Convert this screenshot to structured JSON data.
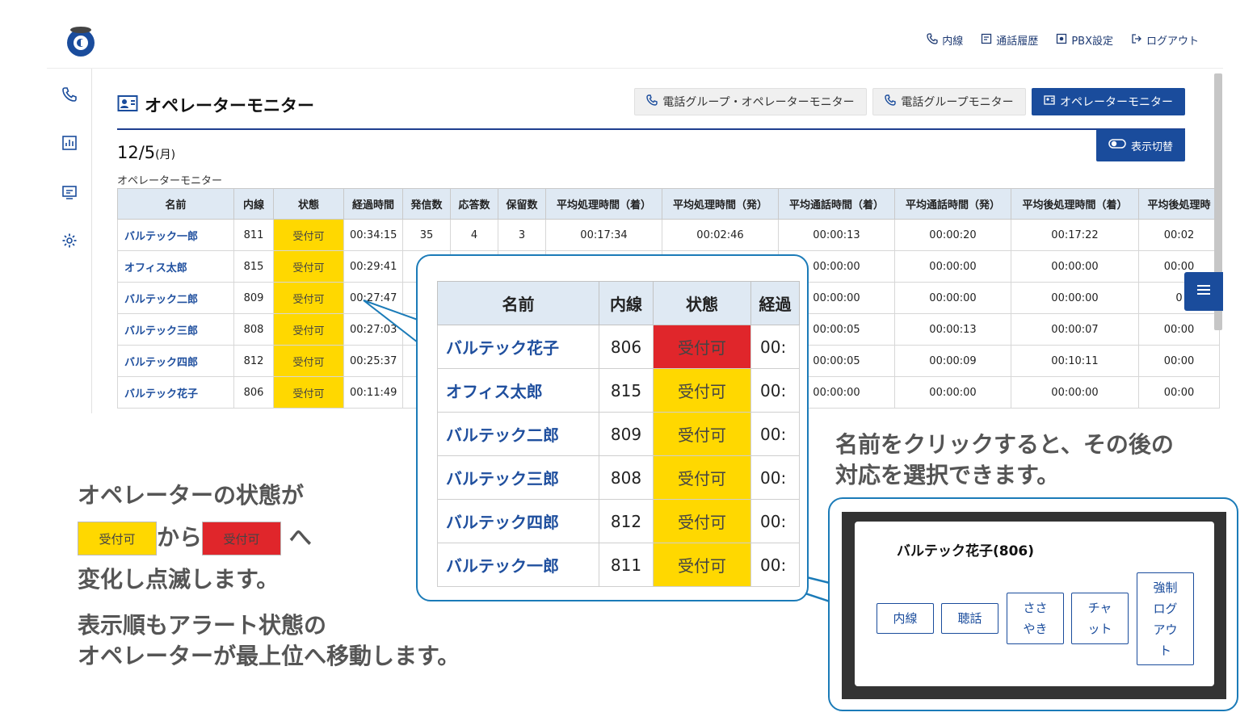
{
  "header": {
    "nav": [
      {
        "label": "内線",
        "icon": "phone-icon"
      },
      {
        "label": "通話履歴",
        "icon": "history-icon"
      },
      {
        "label": "PBX設定",
        "icon": "settings-box-icon"
      },
      {
        "label": "ログアウト",
        "icon": "logout-icon"
      }
    ]
  },
  "sidebar": {
    "icons": [
      "phone-icon",
      "chart-icon",
      "monitor-icon",
      "gear-icon"
    ]
  },
  "page": {
    "title": "オペレーターモニター",
    "tabs": [
      "電話グループ・オペレーターモニター",
      "電話グループモニター",
      "オペレーターモニター"
    ],
    "toggle_label": "表示切替",
    "date": "12/5",
    "weekday": "(月)",
    "sublabel": "オペレーターモニター"
  },
  "table": {
    "headers": [
      "名前",
      "内線",
      "状態",
      "経過時間",
      "発信数",
      "応答数",
      "保留数",
      "平均処理時間（着）",
      "平均処理時間（発）",
      "平均通話時間（着）",
      "平均通話時間（発）",
      "平均後処理時間（着）",
      "平均後処理時"
    ],
    "rows": [
      [
        "バルテック一郎",
        "811",
        "受付可",
        "00:34:15",
        "35",
        "4",
        "3",
        "00:17:34",
        "00:02:46",
        "00:00:13",
        "00:00:20",
        "00:17:22",
        "00:02"
      ],
      [
        "オフィス太郎",
        "815",
        "受付可",
        "00:29:41",
        "",
        "",
        "",
        "",
        "",
        "00:00:00",
        "00:00:00",
        "00:00:00",
        "00:00"
      ],
      [
        "バルテック二郎",
        "809",
        "受付可",
        "00:27:47",
        "",
        "",
        "",
        "",
        "",
        "00:00:00",
        "00:00:00",
        "00:00:00",
        "0"
      ],
      [
        "バルテック三郎",
        "808",
        "受付可",
        "00:27:03",
        "",
        "",
        "",
        "",
        "",
        "00:00:05",
        "00:00:13",
        "00:00:07",
        "00:00"
      ],
      [
        "バルテック四郎",
        "812",
        "受付可",
        "00:25:37",
        "",
        "",
        "",
        "",
        "",
        "00:00:05",
        "00:00:09",
        "00:10:11",
        "00:00"
      ],
      [
        "バルテック花子",
        "806",
        "受付可",
        "00:11:49",
        "",
        "",
        "",
        "",
        "",
        "00:00:00",
        "00:00:00",
        "00:00:00",
        "00:00"
      ]
    ]
  },
  "zoom": {
    "headers": [
      "名前",
      "内線",
      "状態",
      "経過"
    ],
    "rows": [
      [
        "バルテック花子",
        "806",
        "受付可",
        "00:"
      ],
      [
        "オフィス太郎",
        "815",
        "受付可",
        "00:"
      ],
      [
        "バルテック二郎",
        "809",
        "受付可",
        "00:"
      ],
      [
        "バルテック三郎",
        "808",
        "受付可",
        "00:"
      ],
      [
        "バルテック四郎",
        "812",
        "受付可",
        "00:"
      ],
      [
        "バルテック一郎",
        "811",
        "受付可",
        "00:"
      ]
    ],
    "alert_row_index": 0
  },
  "notes": {
    "line1": "オペレーターの状態が",
    "chip_label": "受付可",
    "from": "から",
    "to": "へ",
    "line3": "変化し点滅します。",
    "line4": "表示順もアラート状態の",
    "line5": "オペレーターが最上位へ移動します。",
    "right1": "名前をクリックすると、その後の",
    "right2": "対応を選択できます。"
  },
  "colors": {
    "accent": "#1a4c9c",
    "status_ok": "#ffd800",
    "status_alert": "#e0262b",
    "callout_border": "#1b7bb8"
  },
  "dialog": {
    "title": "バルテック花子(806)",
    "buttons": [
      "内線",
      "聴話",
      "ささやき",
      "チャット",
      "強制ログアウト"
    ]
  }
}
